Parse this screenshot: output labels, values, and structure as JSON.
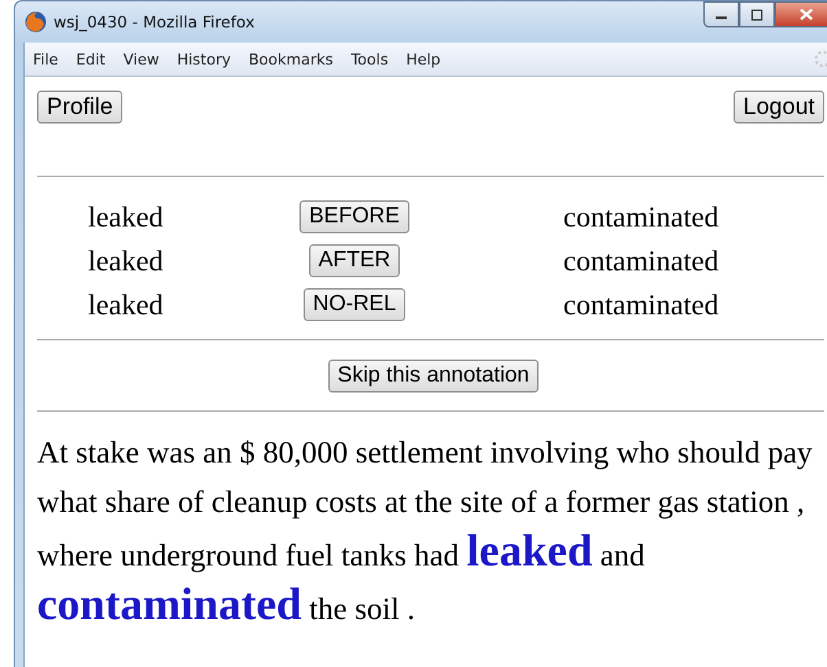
{
  "window": {
    "title": "wsj_0430 - Mozilla Firefox"
  },
  "menu": [
    "File",
    "Edit",
    "View",
    "History",
    "Bookmarks",
    "Tools",
    "Help"
  ],
  "header_buttons": [
    "Profile",
    "Logout"
  ],
  "relations": [
    {
      "source": "leaked",
      "button": "BEFORE",
      "target": "contaminated"
    },
    {
      "source": "leaked",
      "button": "AFTER",
      "target": "contaminated"
    },
    {
      "source": "leaked",
      "button": "NO-REL",
      "target": "contaminated"
    }
  ],
  "skip_button": "Skip this annotation",
  "sentence": "At stake was an $ 80,000 settlement involving who should pay what share of cleanup costs at the site of a former gas station , where underground fuel tanks had **leaked** and **contaminated** the soil ."
}
